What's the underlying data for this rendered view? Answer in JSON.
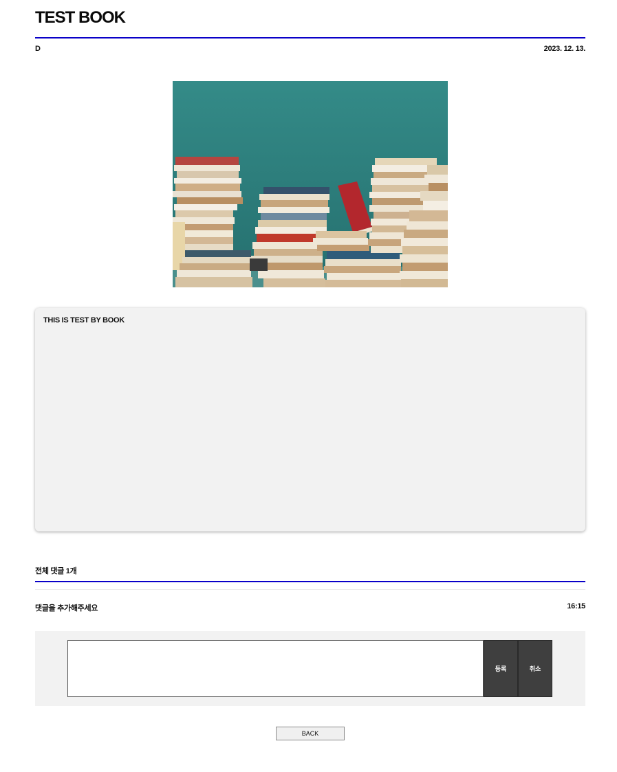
{
  "post": {
    "title": "TEST BOOK",
    "author": "D",
    "date": "2023. 12. 13.",
    "content": "THIS IS TEST BY BOOK",
    "image_icon": "book-stack-photo"
  },
  "comments": {
    "count_label": "전체 댓글 1개",
    "items": [
      {
        "text": "댓글을 추가해주세요",
        "time": "16:15"
      }
    ]
  },
  "comment_form": {
    "placeholder": "",
    "submit_label": "등록",
    "cancel_label": "취소"
  },
  "nav": {
    "back_label": "BACK"
  },
  "colors": {
    "accent_rule": "#0a00c8",
    "button_dark": "#3f3f3f",
    "panel_bg": "#f2f2f2",
    "image_wall": "#2f8583"
  }
}
